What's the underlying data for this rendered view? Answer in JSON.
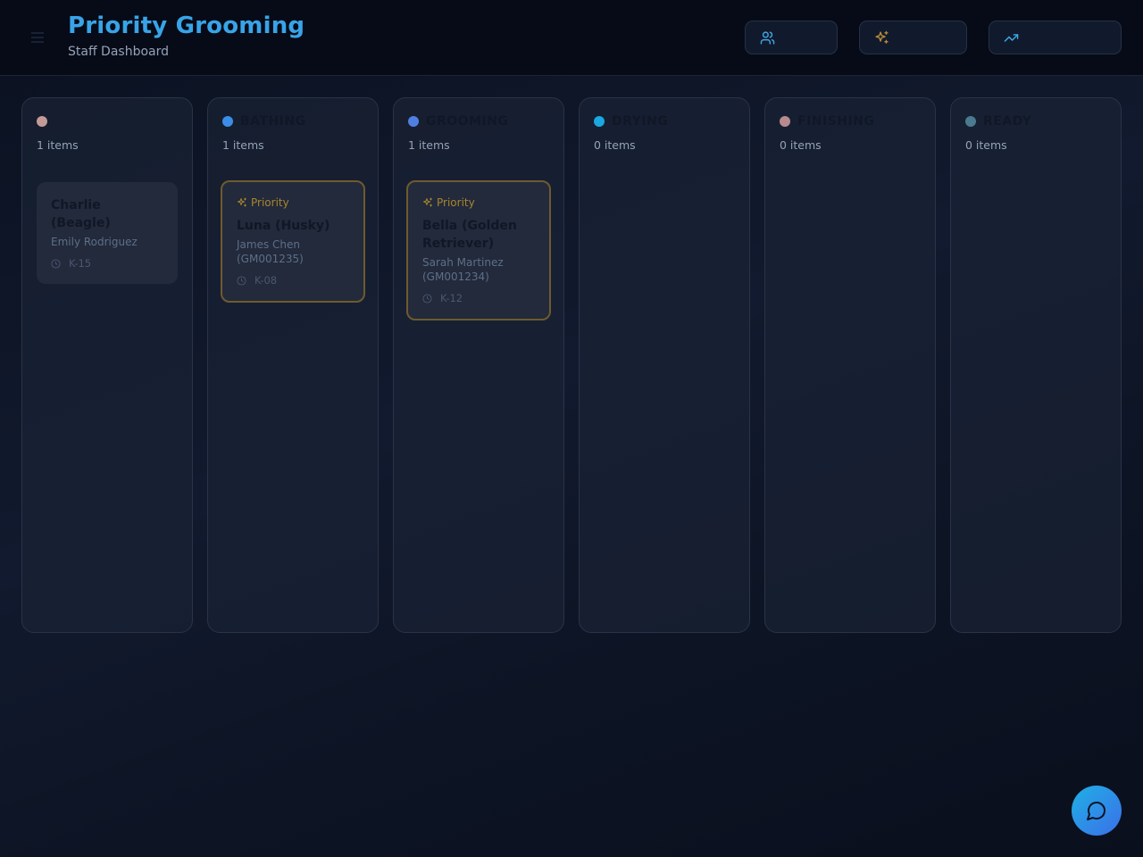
{
  "header": {
    "title": "Priority Grooming",
    "subtitle": "Staff Dashboard",
    "menu_icon": "menu-icon",
    "buttons": [
      {
        "icon": "users-icon",
        "label": ""
      },
      {
        "icon": "sparkles-icon",
        "label": ""
      },
      {
        "icon": "trending-up-icon",
        "label": ""
      }
    ]
  },
  "colors": {
    "accent": "#38a4e8",
    "priority": "#a8852d",
    "dot_checkin": "#c49a96",
    "dot_bathing": "#3b8ee8",
    "dot_grooming": "#4f7fe0",
    "dot_drying": "#1aa8e0",
    "dot_finishing": "#b88a8e",
    "dot_ready": "#4a7a90"
  },
  "columns": [
    {
      "name": "",
      "count": "1 items",
      "cards": [
        {
          "priority": false,
          "pet": "Charlie (Beagle)",
          "owner": "Emily Rodriguez",
          "kennel": "K-15"
        }
      ]
    },
    {
      "name": "BATHING",
      "count": "1 items",
      "cards": [
        {
          "priority": true,
          "priority_label": "Priority",
          "pet": "Luna (Husky)",
          "owner": "James Chen (GM001235)",
          "kennel": "K-08"
        }
      ]
    },
    {
      "name": "GROOMING",
      "count": "1 items",
      "cards": [
        {
          "priority": true,
          "priority_label": "Priority",
          "pet": "Bella (Golden Retriever)",
          "owner": "Sarah Martinez (GM001234)",
          "kennel": "K-12"
        }
      ]
    },
    {
      "name": "DRYING",
      "count": "0 items",
      "cards": []
    },
    {
      "name": "FINISHING",
      "count": "0 items",
      "cards": []
    },
    {
      "name": "READY",
      "count": "0 items",
      "cards": []
    }
  ],
  "chat": {
    "icon": "chat-bubble-icon"
  }
}
